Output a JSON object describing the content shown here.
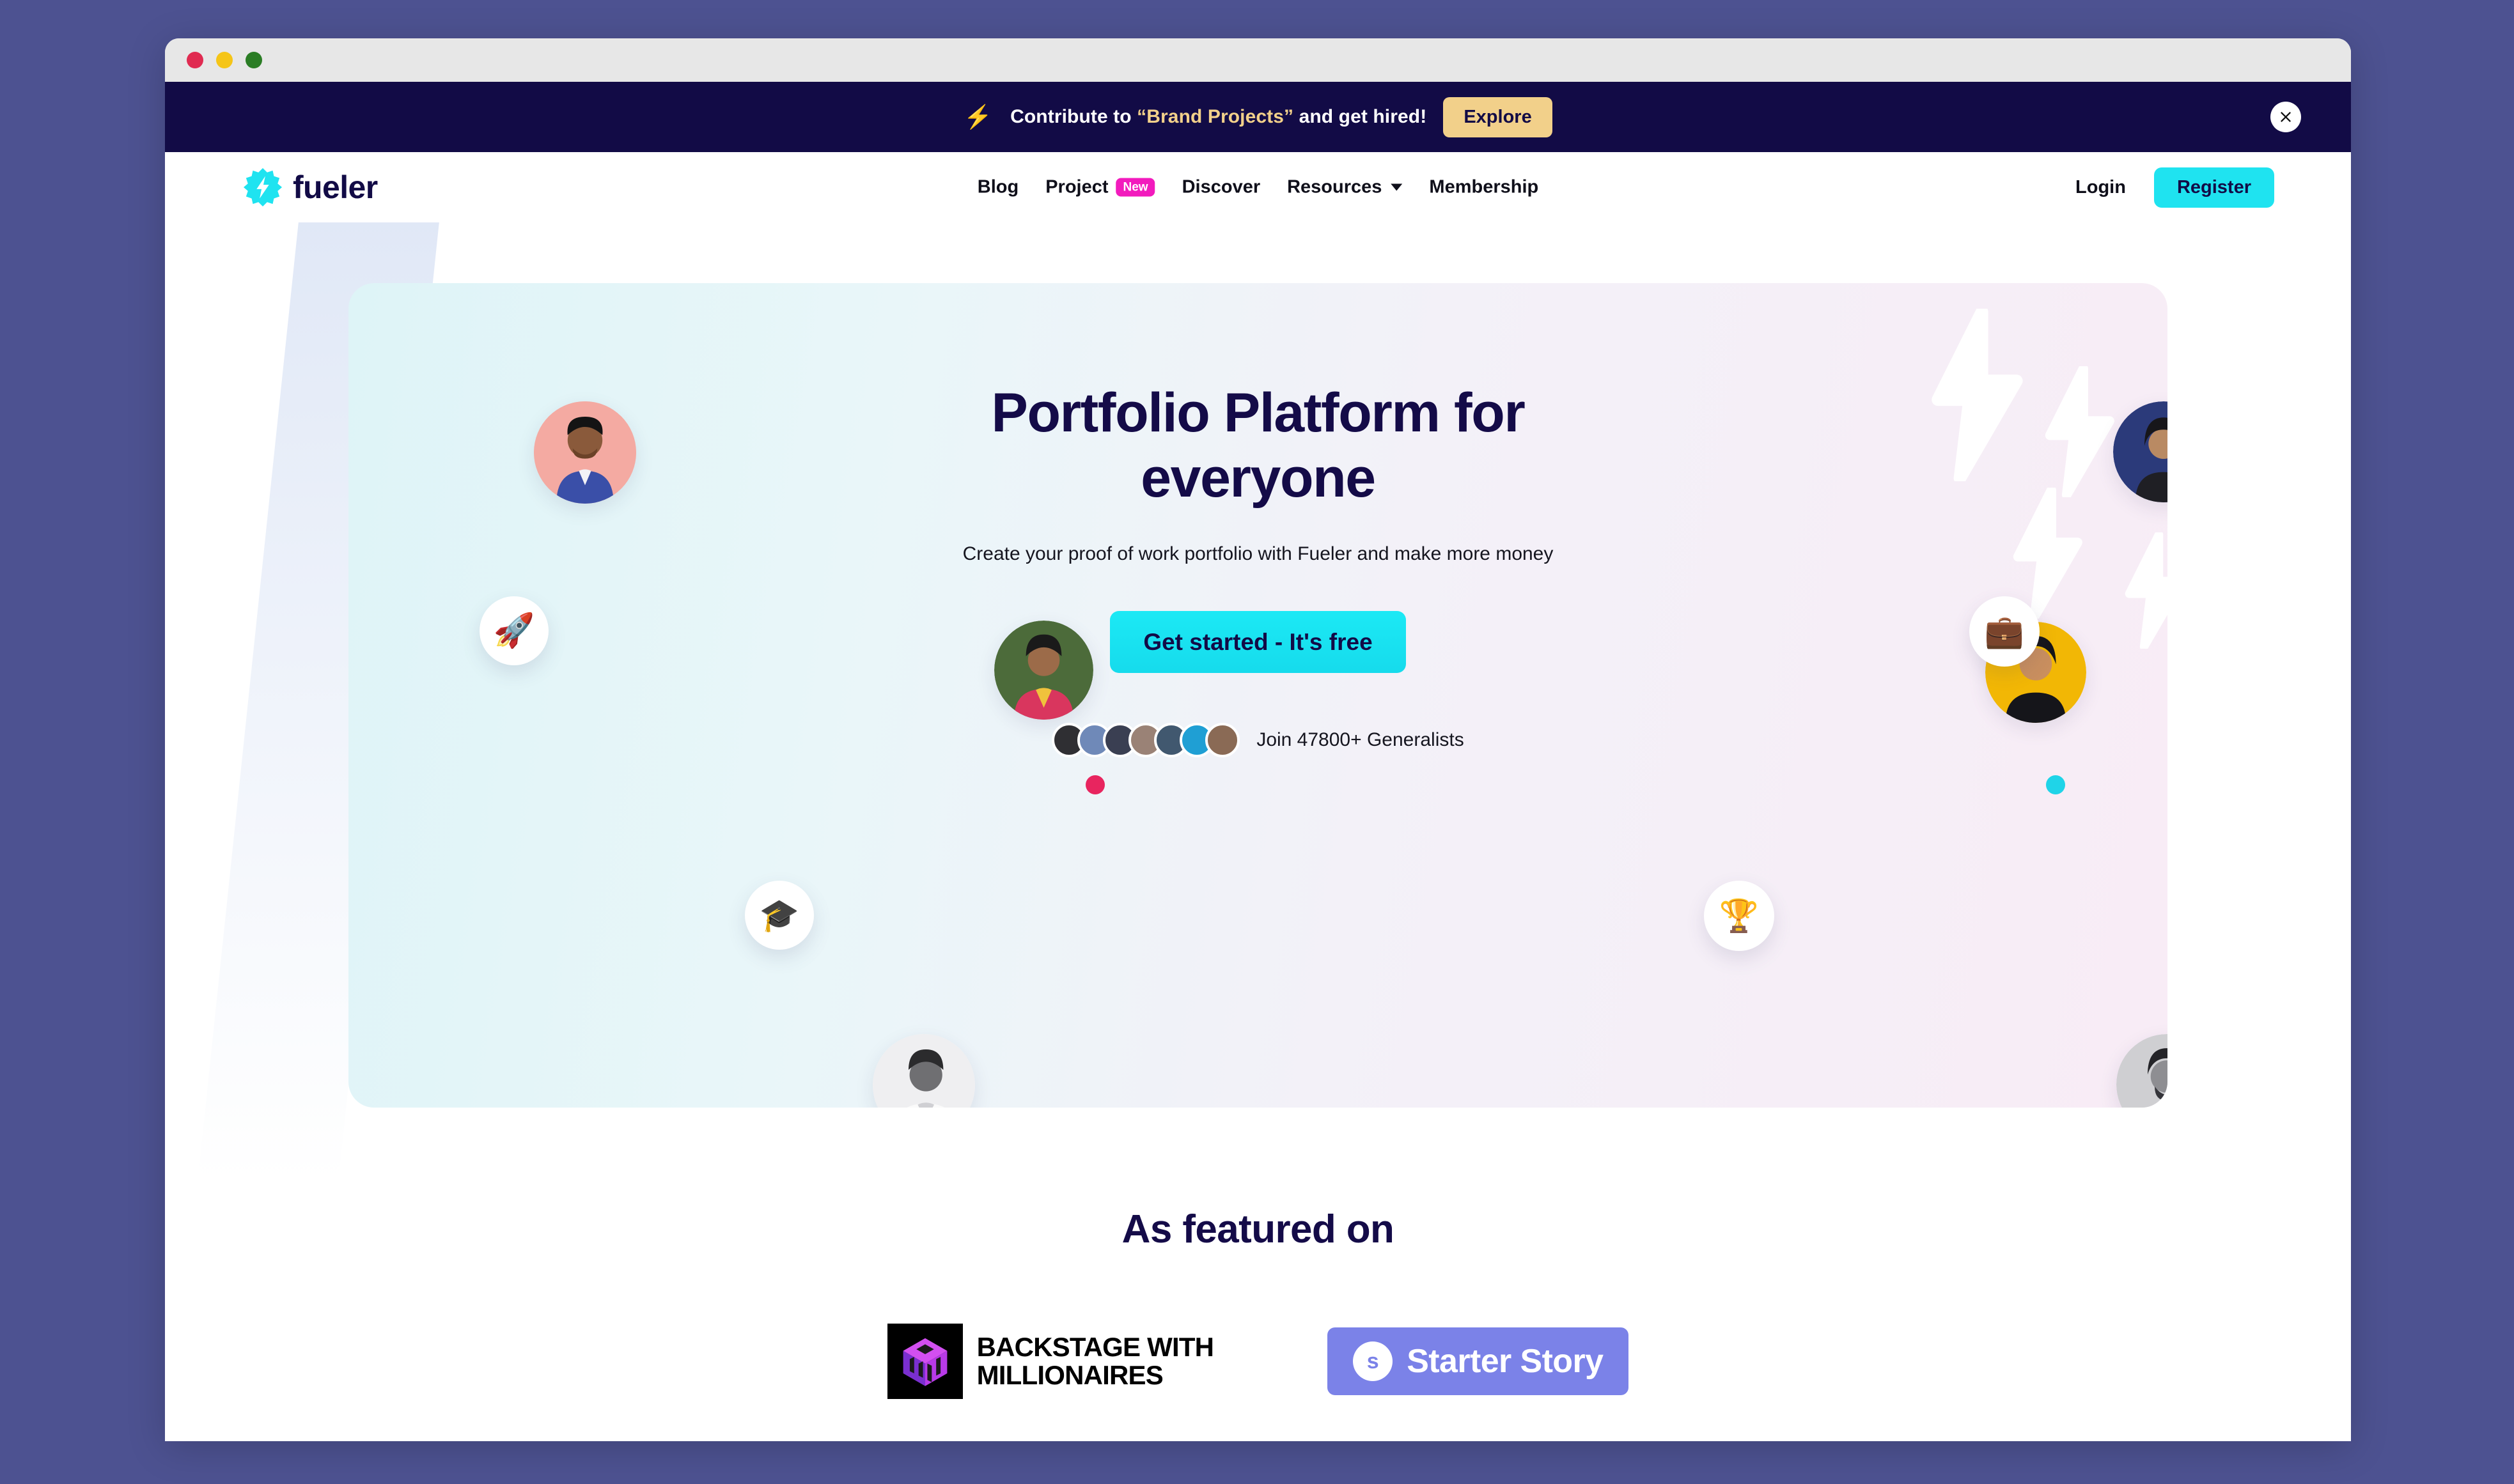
{
  "window": {
    "traffic_lights": [
      "close",
      "minimize",
      "zoom"
    ],
    "colors": {
      "desktop_background": "#4d5291",
      "titlebar": "#e7e7e7",
      "red": "#e02b51",
      "yellow": "#f5c518",
      "green": "#2b7d25"
    }
  },
  "promo_banner": {
    "bolt_icon": "⚡",
    "text_before": "Contribute to ",
    "highlight": "“Brand Projects”",
    "text_after": " and get hired!",
    "explore_label": "Explore",
    "close_icon": "close-icon",
    "background": "#120b46",
    "accent": "#f2d08a"
  },
  "navbar": {
    "brand_name": "fueler",
    "brand_icon": "fueler-bolt-logo",
    "links": [
      {
        "label": "Blog",
        "badge": null,
        "has_caret": false
      },
      {
        "label": "Project",
        "badge": "New",
        "has_caret": false
      },
      {
        "label": "Discover",
        "badge": null,
        "has_caret": false
      },
      {
        "label": "Resources",
        "badge": null,
        "has_caret": true
      },
      {
        "label": "Membership",
        "badge": null,
        "has_caret": false
      }
    ],
    "login_label": "Login",
    "register_label": "Register",
    "register_color": "#1fe3f0",
    "badge_color": "#f21bbd"
  },
  "hero": {
    "title_line1": "Portfolio Platform for",
    "title_line2": "everyone",
    "subtitle": "Create your proof of work portfolio with Fueler and make more money",
    "cta_label": "Get started - It's free",
    "social_proof_text": "Join 47800+ Generalists",
    "title_color": "#140b48",
    "gradient_start": "#def4f7",
    "gradient_end": "#f8ecf6",
    "badges": [
      {
        "icon": "rocket-icon",
        "glyph": "🚀"
      },
      {
        "icon": "graduation-cap-icon",
        "glyph": "🎓"
      },
      {
        "icon": "briefcase-icon",
        "glyph": "💼"
      },
      {
        "icon": "trophy-icon",
        "glyph": "🏆"
      }
    ],
    "dots": [
      {
        "name": "dot-pink",
        "color": "#e8255f"
      },
      {
        "name": "dot-cyan-left",
        "color": "#1fd4e8"
      },
      {
        "name": "dot-amber",
        "color": "#f5a623"
      },
      {
        "name": "dot-cyan-right",
        "color": "#1fd4e8"
      }
    ]
  },
  "featured": {
    "title": "As featured on",
    "logos": [
      {
        "name": "backstage-with-millionaires",
        "line1": "BACKSTAGE WITH",
        "line2": "MILLIONAIRES"
      },
      {
        "name": "starter-story",
        "mark": "s",
        "label": "Starter Story",
        "color": "#7b82e8"
      }
    ]
  }
}
